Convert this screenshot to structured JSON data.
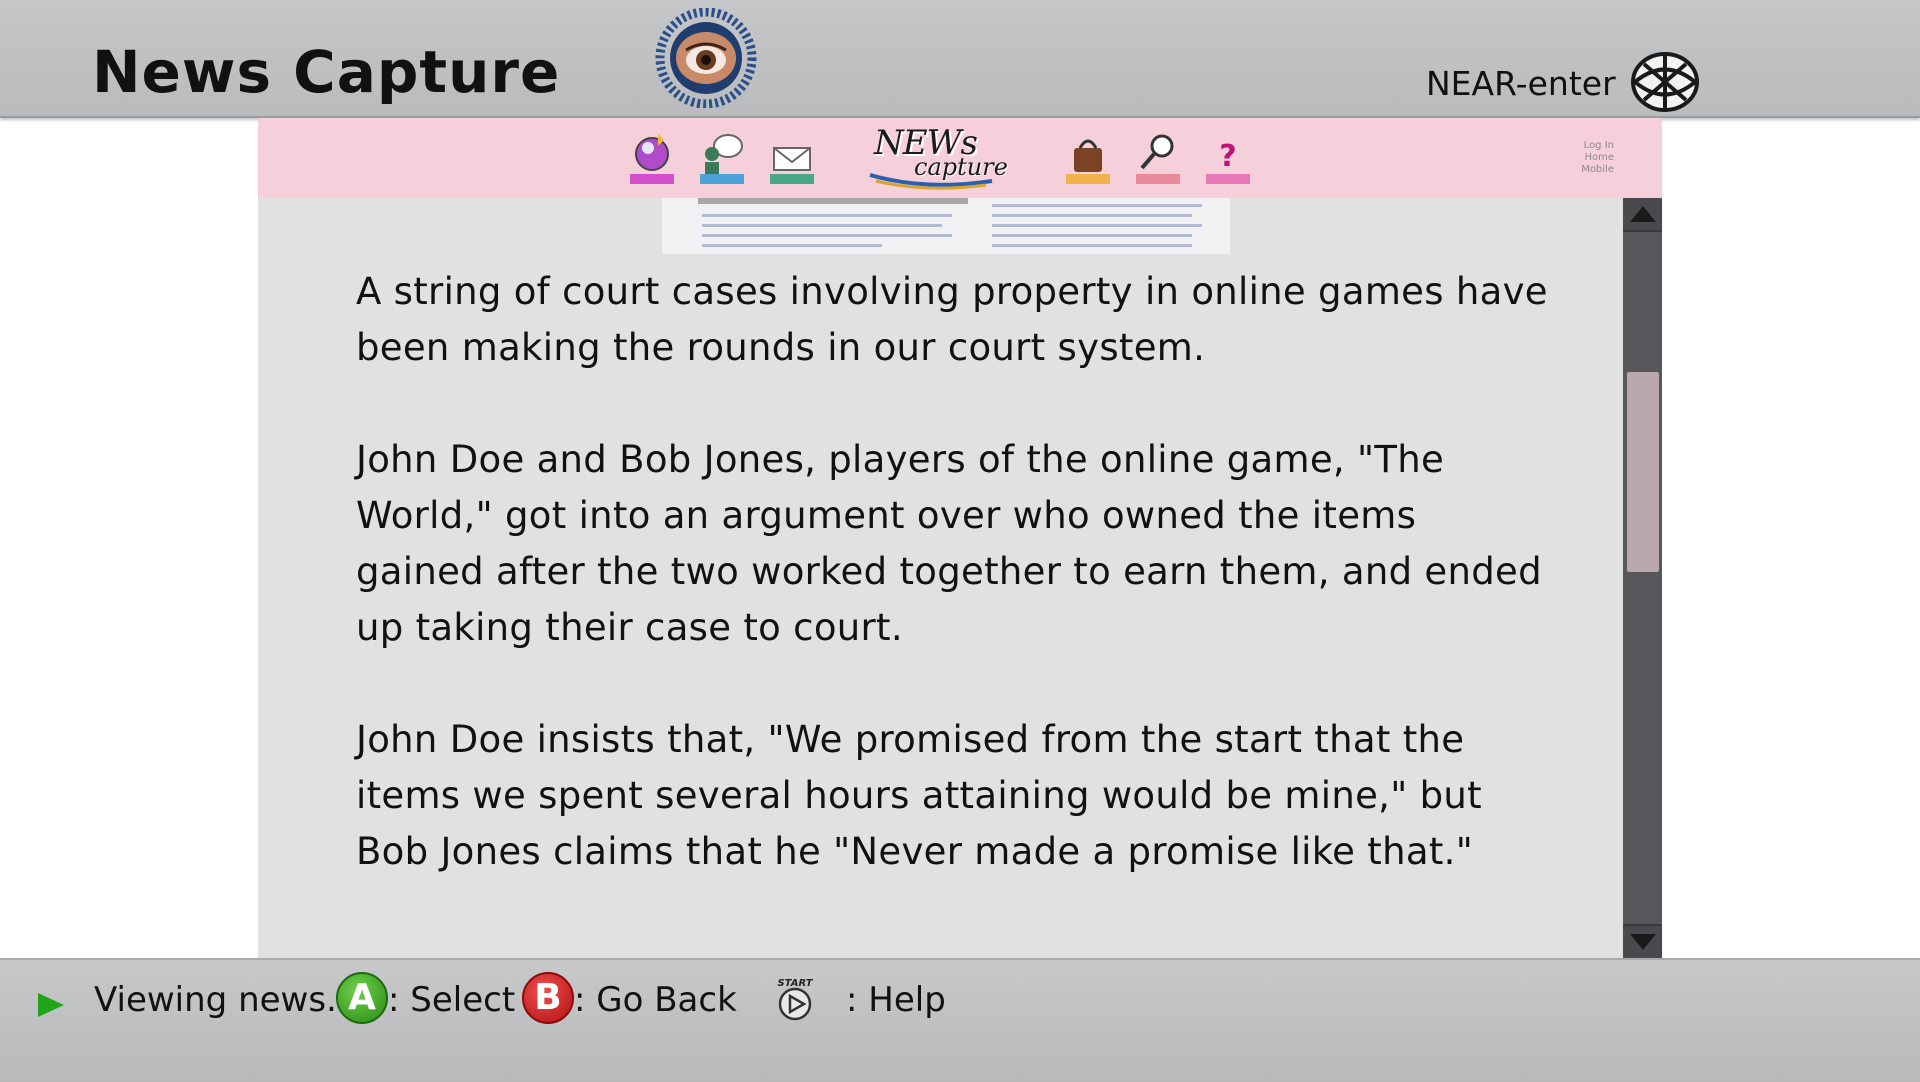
{
  "header": {
    "title": "News Capture",
    "network_label": "NEAR-enter"
  },
  "icons": {
    "emblem": "eye-emblem-icon",
    "network": "globe-icon",
    "nav": [
      "globe-nav-icon",
      "chat-icon",
      "mail-icon",
      "shop-bag-icon",
      "search-icon",
      "help-icon"
    ]
  },
  "navbar": {
    "logo_line1": "NEWs",
    "logo_line2": "capture",
    "side_links": [
      "Log In",
      "Home",
      "Mobile"
    ]
  },
  "article": {
    "paragraphs": [
      "A string of court cases involving property in online games have been making the rounds in our court system.",
      "John Doe and Bob Jones, players of the online game, \"The World,\" got into an argument over who owned the items gained after the two worked together to earn them, and ended up taking their case to court.",
      "John Doe insists that, \"We promised from the start that the items we spent several hours attaining would be mine,\" but Bob Jones claims that he \"Never made a promise like that.\""
    ]
  },
  "status_bar": {
    "status_text": "Viewing news.",
    "a_button": "A",
    "a_action": ": Select",
    "b_button": "B",
    "b_action": ": Go Back",
    "start_label": "START",
    "help_action": ": Help"
  },
  "colors": {
    "navbar_bg": "#f5cfd9",
    "content_bg": "#e1e1e1",
    "scrollbar": "#57565a",
    "scroll_thumb": "#b9a9ad",
    "a_button": "#2a8a15",
    "b_button": "#c01414",
    "play_arrow": "#22a51a"
  }
}
